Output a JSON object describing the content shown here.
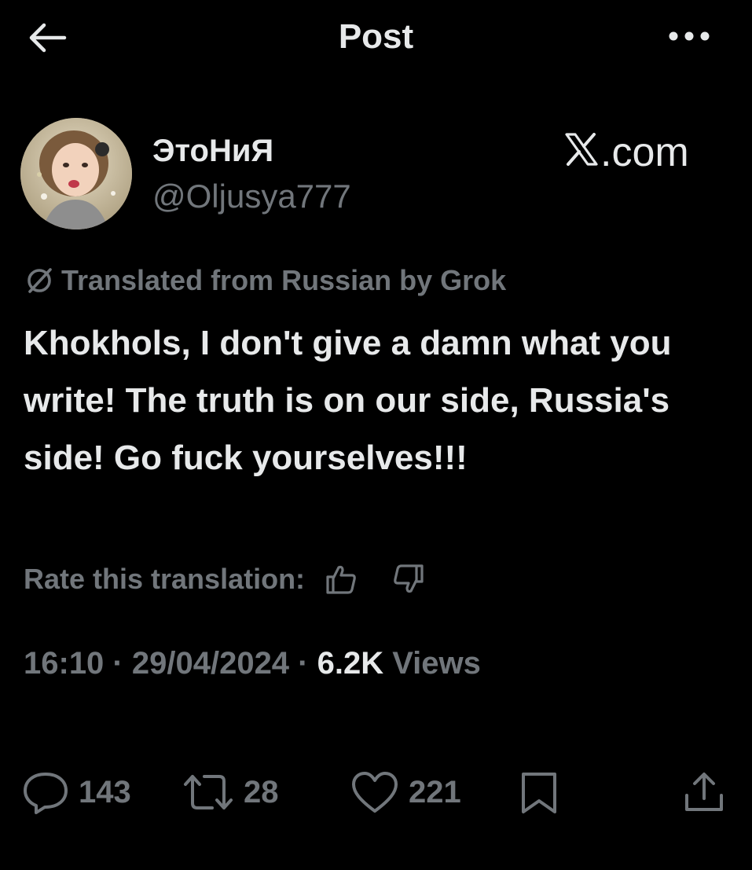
{
  "header": {
    "title": "Post"
  },
  "author": {
    "display_name": "ЭтоНиЯ",
    "handle": "@Oljusya777"
  },
  "watermark": {
    "text": ".com"
  },
  "translation": {
    "note": "Translated from Russian by Grok",
    "rate_label": "Rate this translation:"
  },
  "post": {
    "text": "Khokhols, I don't give a damn what you write! The truth is on our side, Russia's side! Go fuck yourselves!!!"
  },
  "meta": {
    "time": "16:10",
    "sep1": " · ",
    "date": "29/04/2024",
    "sep2": " · ",
    "views_count": "6.2K",
    "views_label": " Views"
  },
  "actions": {
    "replies": "143",
    "reposts": "28",
    "likes": "221"
  },
  "icons": {
    "back": "arrow-left-icon",
    "more": "more-horizontal-icon",
    "x_logo": "x-logo-icon",
    "translate": "translate-slash-icon",
    "thumbs_up": "thumbs-up-icon",
    "thumbs_down": "thumbs-down-icon",
    "reply": "reply-icon",
    "repost": "repost-icon",
    "like": "heart-icon",
    "bookmark": "bookmark-icon",
    "share": "share-icon"
  },
  "colors": {
    "background": "#000000",
    "primary_text": "#e7e9ea",
    "secondary_text": "#71767b"
  }
}
